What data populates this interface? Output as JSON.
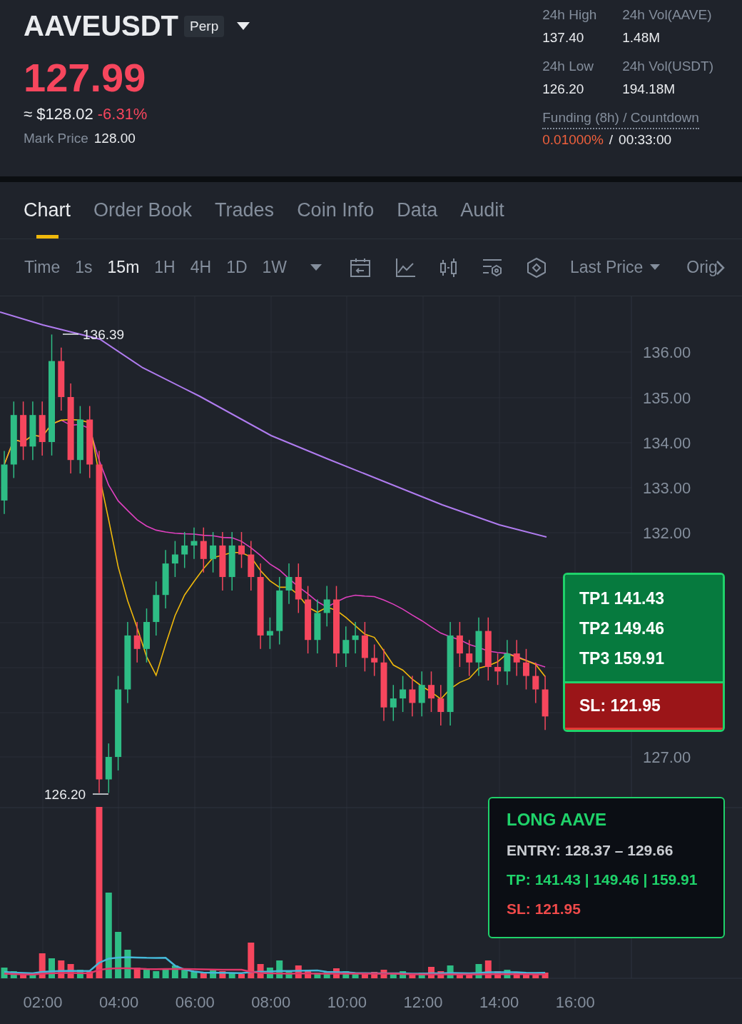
{
  "header": {
    "symbol": "AAVEUSDT",
    "contract_badge": "Perp",
    "last_price": "127.99",
    "price_usd": "≈ $128.02",
    "change": "-6.31%",
    "mark_price_label": "Mark Price",
    "mark_price": "128.00"
  },
  "stats": [
    {
      "label": "24h High",
      "value": "137.40"
    },
    {
      "label": "24h Vol(AAVE)",
      "value": "1.48M"
    },
    {
      "label": "24h Low",
      "value": "126.20"
    },
    {
      "label": "24h Vol(USDT)",
      "value": "194.18M"
    }
  ],
  "funding": {
    "label": "Funding (8h) / Countdown",
    "rate": "0.01000%",
    "separator": "/",
    "countdown": "00:33:00"
  },
  "tabs": [
    {
      "label": "Chart",
      "selected": true
    },
    {
      "label": "Order Book",
      "selected": false
    },
    {
      "label": "Trades",
      "selected": false
    },
    {
      "label": "Coin Info",
      "selected": false
    },
    {
      "label": "Data",
      "selected": false
    },
    {
      "label": "Audit",
      "selected": false
    }
  ],
  "toolbar": {
    "intervals": [
      {
        "label": "Time",
        "selected": false
      },
      {
        "label": "1s",
        "selected": false
      },
      {
        "label": "15m",
        "selected": true
      },
      {
        "label": "1H",
        "selected": false
      },
      {
        "label": "4H",
        "selected": false
      },
      {
        "label": "1D",
        "selected": false
      },
      {
        "label": "1W",
        "selected": false
      }
    ],
    "price_type": "Last Price",
    "more": "Orig"
  },
  "chart": {
    "y_labels": [
      "136.00",
      "135.00",
      "134.00",
      "133.00",
      "132.00",
      "127.00"
    ],
    "x_labels": [
      "02:00",
      "04:00",
      "06:00",
      "08:00",
      "10:00",
      "12:00",
      "14:00",
      "16:00"
    ],
    "high_marker": "136.39",
    "low_marker": "126.20"
  },
  "trade_levels": {
    "take_profits": [
      "TP1 141.43",
      "TP2 149.46",
      "TP3 159.91"
    ],
    "stop_loss": "SL: 121.95"
  },
  "signal_card": {
    "title": "LONG AAVE",
    "entry": "ENTRY: 128.37 – 129.66",
    "targets": "TP: 141.43 | 149.46 | 159.91",
    "stop": "SL: 121.95"
  }
}
